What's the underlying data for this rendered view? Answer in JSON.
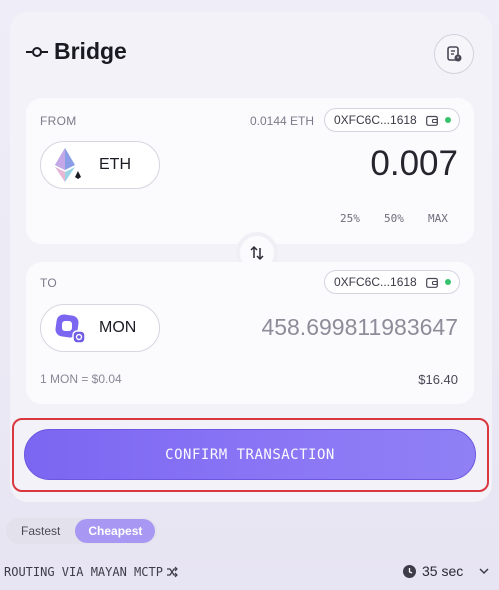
{
  "header": {
    "title": "Bridge"
  },
  "from": {
    "label": "FROM",
    "balance": "0.0144 ETH",
    "address": "0XFC6C...1618",
    "token": "ETH",
    "amount": "0.007",
    "percents": [
      "25%",
      "50%",
      "MAX"
    ]
  },
  "to": {
    "label": "TO",
    "address": "0XFC6C...1618",
    "token": "MON",
    "amount": "458.699811983647",
    "rate": "1 MON = $0.04",
    "usd_value": "$16.40"
  },
  "confirm_label": "CONFIRM TRANSACTION",
  "route_modes": [
    {
      "label": "Fastest",
      "active": false
    },
    {
      "label": "Cheapest",
      "active": true
    }
  ],
  "routing_text": "ROUTING VIA MAYAN MCTP",
  "eta": "35 sec",
  "colors": {
    "accent": "#7b66f2",
    "status_dot": "#38c26b",
    "highlight": "#d9383e"
  },
  "icons": [
    "bridge-icon",
    "history-icon",
    "eth-icon",
    "wallet-icon",
    "swap-icon",
    "mon-icon",
    "shuffle-icon",
    "clock-icon",
    "chevron-down-icon"
  ]
}
